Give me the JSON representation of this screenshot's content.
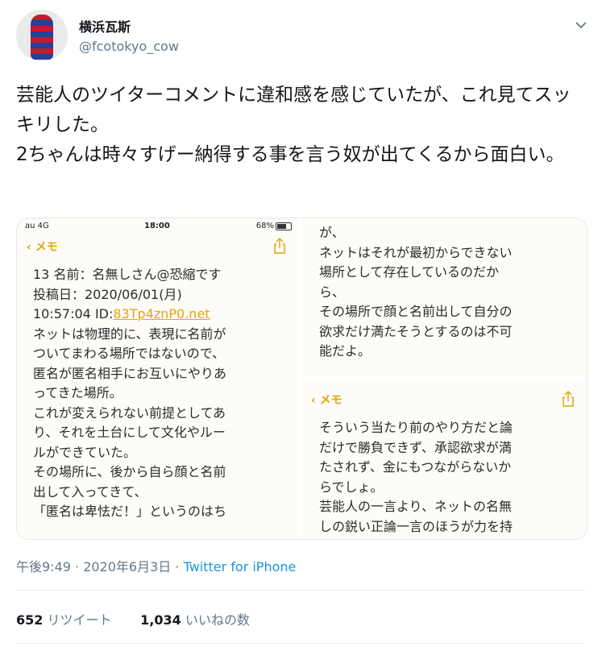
{
  "author": {
    "display_name": "横浜瓦斯",
    "handle": "@fcotokyo_cow"
  },
  "tweet": {
    "text": "芸能人のツイターコメントに違和感を感じていたが、これ見てスッキリした。\n2ちゃんは時々すげー納得する事を言う奴が出てくるから面白い。"
  },
  "media": {
    "left": {
      "status": {
        "signal": "au 4G",
        "time": "18:00",
        "battery": "68%"
      },
      "back_label": "メモ",
      "line1": "13 名前：名無しさん@恐縮です",
      "line2": "投稿日：2020/06/01(月)",
      "line3_prefix": "10:57:04 ID:",
      "line3_id": "83Tp4znP0.net",
      "body": "ネットは物理的に、表現に名前が\nついてまわる場所ではないので、\n匿名が匿名相手にお互いにやりあ\nってきた場所。\nこれが変えられない前提としてあ\nり、それを土台にして文化やルー\nルができていた。\nその場所に、後から自ら顔と名前\n出して入ってきて、\n「匿名は卑怯だ！」というのはち"
    },
    "top_right": {
      "body": "が、\nネットはそれが最初からできない\n場所として存在しているのだか\nら、\nその場所で顔と名前出して自分の\n欲求だけ満たそうとするのは不可\n能だよ。"
    },
    "bottom_right": {
      "back_label": "メモ",
      "body": "そういう当たり前のやり方だと論\nだけで勝負できず、承認欲求が満\nたされず、金にもつながらないか\nらでしょ。\n芸能人の一言より、ネットの名無\nしの鋭い正論一言のほうが力を持"
    }
  },
  "meta": {
    "time": "午後9:49",
    "dot": " · ",
    "date": "2020年6月3日",
    "dot2": " · ",
    "source": "Twitter for iPhone"
  },
  "stats": {
    "retweets_count": "652",
    "retweets_label": "リツイート",
    "likes_count": "1,034",
    "likes_label": "いいねの数"
  },
  "colors": {
    "accent_link": "#1b95e0",
    "notes_yellow": "#e2a60f",
    "muted": "#657786"
  }
}
